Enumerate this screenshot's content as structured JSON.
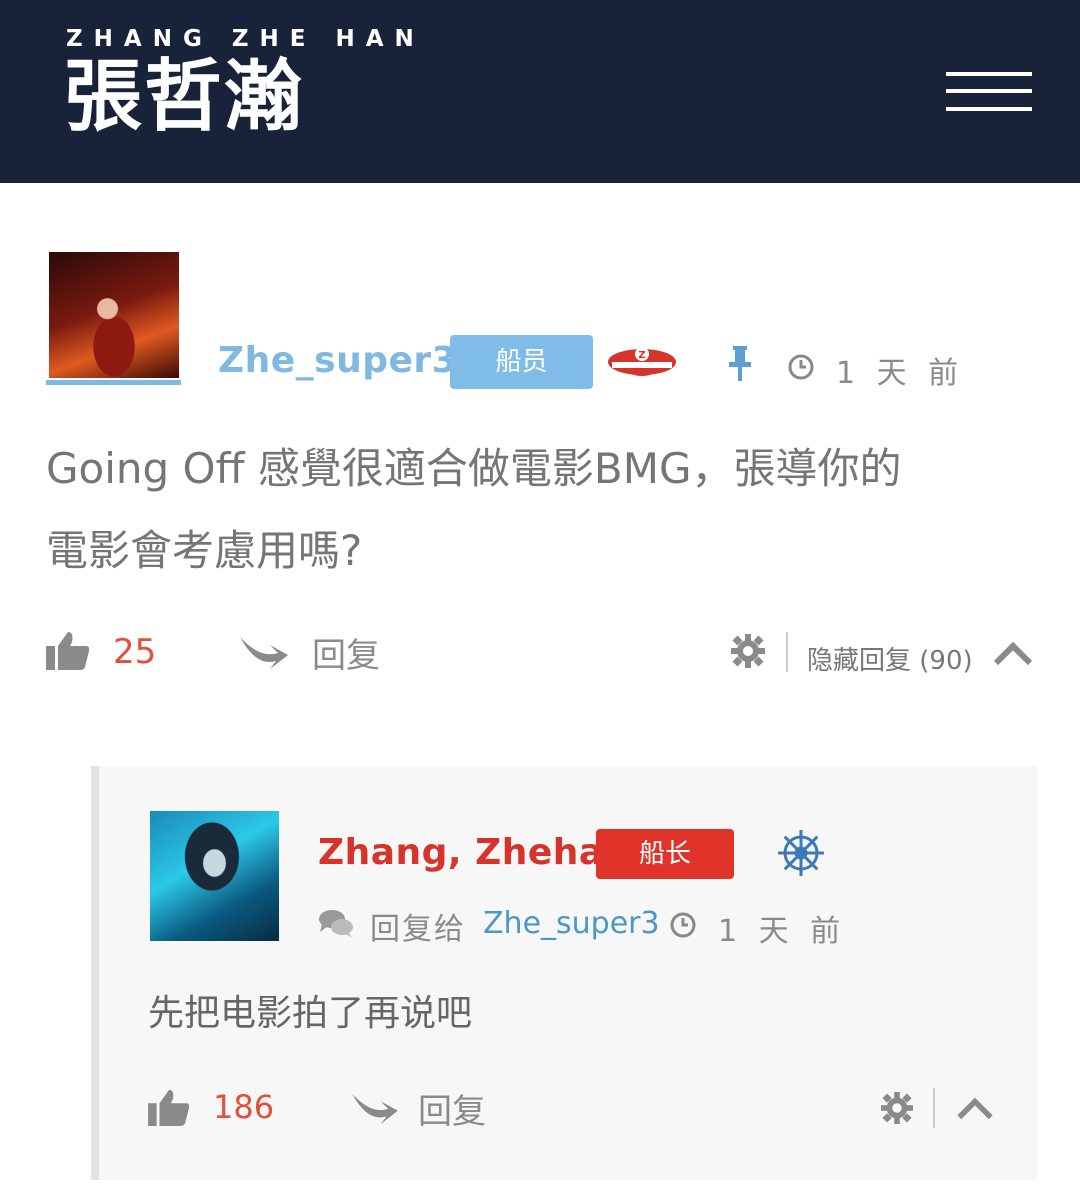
{
  "header": {
    "logo_subtitle": "ZHANG ZHE HAN",
    "logo_title": "張哲瀚",
    "menu_icon": "hamburger-menu-icon"
  },
  "colors": {
    "header_bg": "#182238",
    "member_blue": "#7fb8e0",
    "captain_red": "#d6332b",
    "like_count": "#e0503a",
    "link_blue": "#4b98c8"
  },
  "comment": {
    "author": "Zhe_super3",
    "role_badge": "船员",
    "icons": [
      "sailor-cap-icon",
      "pin-icon",
      "clock-icon"
    ],
    "time": "1 天 前",
    "body_line1": "Going Off 感覺很適合做電影BMG，張導你的",
    "body_line2": "電影會考慮用嗎?",
    "likes": "25",
    "reply_label": "回复",
    "hide_replies_label": "隐藏回复 (90)"
  },
  "reply": {
    "author": "Zhang, Zhehan",
    "role_badge": "船长",
    "icons": [
      "ship-wheel-icon",
      "chat-bubbles-icon",
      "clock-icon"
    ],
    "reply_to_label": "回复给",
    "reply_to_user": "Zhe_super3",
    "time": "1 天 前",
    "body": "先把电影拍了再说吧",
    "likes": "186",
    "reply_label": "回复"
  }
}
